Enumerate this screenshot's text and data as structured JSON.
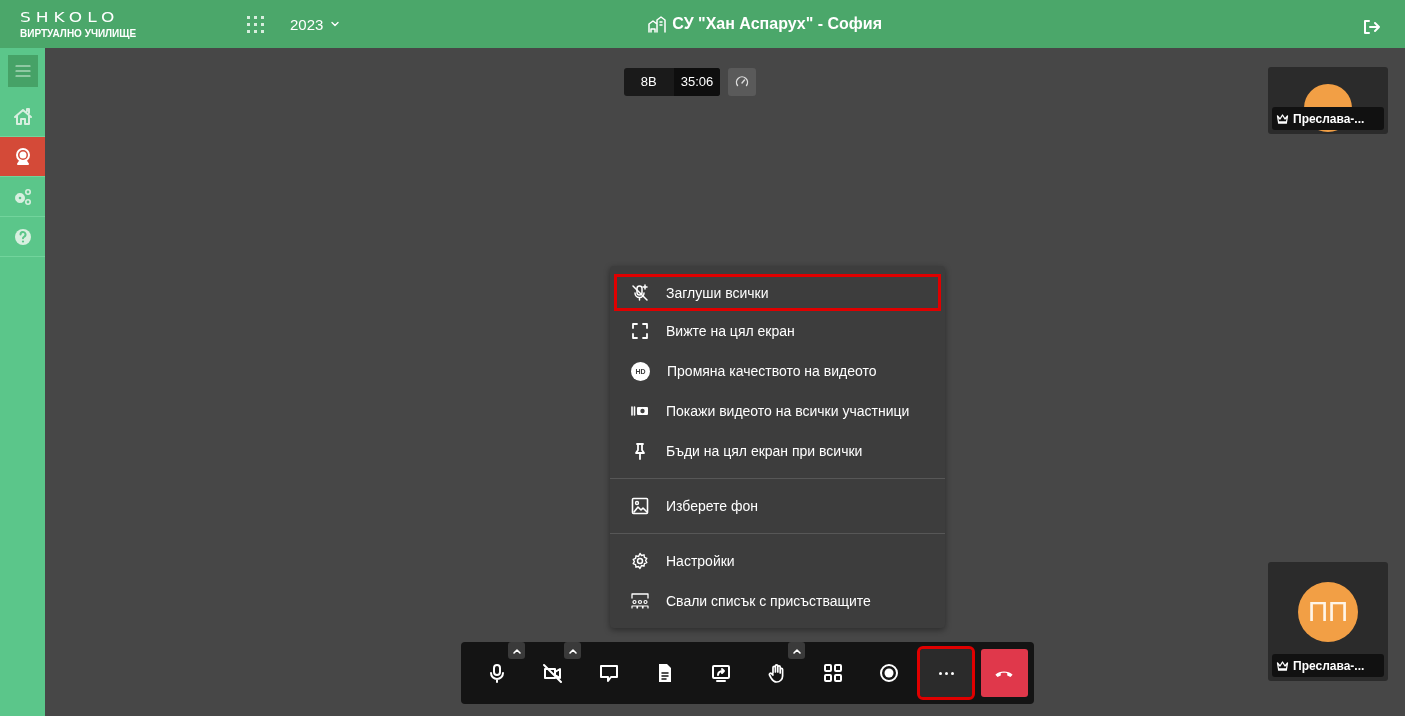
{
  "header": {
    "logo": "SHKOLO",
    "logo_subtitle": "ВИРТУАЛНО УЧИЛИЩЕ",
    "year": "2023",
    "school": "СУ \"Хан Аспарух\" - София"
  },
  "sidebar": {
    "items": [
      {
        "kind": "menu",
        "selected": false
      },
      {
        "kind": "home",
        "selected": false
      },
      {
        "kind": "webcam",
        "selected": true
      },
      {
        "kind": "gears",
        "selected": false
      },
      {
        "kind": "help",
        "selected": false
      }
    ]
  },
  "session": {
    "class_name": "8В",
    "timer": "35:06"
  },
  "participants": [
    {
      "name": "Преслава-..."
    },
    {
      "initials": "ПП",
      "name": "Преслава-..."
    }
  ],
  "more_menu": {
    "groups": [
      [
        {
          "kind": "mute-all",
          "label": "Заглуши всички",
          "highlighted": true
        },
        {
          "kind": "fullscreen",
          "label": "Вижте на цял екран",
          "highlighted": false
        },
        {
          "kind": "hd",
          "badge": "HD",
          "label": "Промяна качеството на видеото",
          "highlighted": false
        },
        {
          "kind": "camera",
          "label": "Покажи видеото на всички участници",
          "highlighted": false
        },
        {
          "kind": "pin",
          "label": "Бъди на цял екран при всички",
          "highlighted": false
        }
      ],
      [
        {
          "kind": "image",
          "label": "Изберете фон",
          "highlighted": false
        }
      ],
      [
        {
          "kind": "gear",
          "label": "Настройки",
          "highlighted": false
        },
        {
          "kind": "people",
          "label": "Свали списък с присъстващите",
          "highlighted": false
        }
      ]
    ]
  },
  "toolbar": [
    {
      "kind": "mic",
      "caret": true,
      "highlighted": false
    },
    {
      "kind": "camera-off",
      "caret": true,
      "highlighted": false
    },
    {
      "kind": "chat",
      "caret": false,
      "highlighted": false
    },
    {
      "kind": "document",
      "caret": false,
      "highlighted": false
    },
    {
      "kind": "share-screen",
      "caret": false,
      "highlighted": false
    },
    {
      "kind": "hand",
      "caret": true,
      "highlighted": false
    },
    {
      "kind": "grid",
      "caret": false,
      "highlighted": false
    },
    {
      "kind": "record",
      "caret": false,
      "highlighted": false
    },
    {
      "kind": "more",
      "caret": false,
      "highlighted": true
    },
    {
      "kind": "hangup",
      "caret": false,
      "highlighted": false
    }
  ]
}
